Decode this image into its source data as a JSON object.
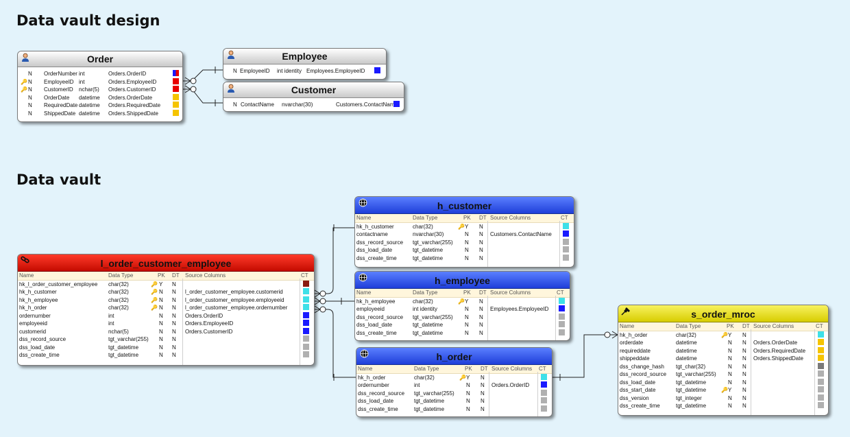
{
  "sections": {
    "design_title": "Data vault design",
    "vault_title": "Data vault"
  },
  "colors": {
    "background": "#e3f3fb",
    "hub_header": "#2a4fe8",
    "link_header": "#d81000",
    "satellite_header": "#e8e020",
    "ct_blue": "#1a1aff",
    "ct_red": "#e80000",
    "ct_yellow": "#f5c400",
    "ct_cyan": "#3ee0e8",
    "ct_grey": "#b0b0b0",
    "ct_darkred": "#8a1a10"
  },
  "order": {
    "title": "Order",
    "rows": [
      {
        "n": "N",
        "name": "OrderNumber",
        "type": "int",
        "src": "Orders.OrderID",
        "ct": "split",
        "key": false
      },
      {
        "n": "N",
        "name": "EmployeeID",
        "type": "int",
        "src": "Orders.EmployeeID",
        "ct": "#e80000",
        "key": true
      },
      {
        "n": "N",
        "name": "CustomerID",
        "type": "nchar(5)",
        "src": "Orders.CustomerID",
        "ct": "#e80000",
        "key": true
      },
      {
        "n": "N",
        "name": "OrderDate",
        "type": "datetime",
        "src": "Orders.OrderDate",
        "ct": "#f5c400",
        "key": false
      },
      {
        "n": "N",
        "name": "RequiredDate",
        "type": "datetime",
        "src": "Orders.RequiredDate",
        "ct": "#f5c400",
        "key": false
      },
      {
        "n": "N",
        "name": "ShippedDate",
        "type": "datetime",
        "src": "Orders.ShippedDate",
        "ct": "#f5c400",
        "key": false
      }
    ]
  },
  "employee": {
    "title": "Employee",
    "rows": [
      {
        "n": "N",
        "name": "EmployeeID",
        "type": "int identity",
        "src": "Employees.EmployeeID",
        "ct": "#1a1aff"
      }
    ]
  },
  "customer": {
    "title": "Customer",
    "rows": [
      {
        "n": "N",
        "name": "ContactName",
        "type": "nvarchar(30)",
        "src": "Customers.ContactName",
        "ct": "#1a1aff"
      }
    ]
  },
  "columns": {
    "name": "Name",
    "type": "Data Type",
    "pk": "PK",
    "dt": "DT",
    "src": "Source Columns",
    "ct": "CT"
  },
  "h_customer": {
    "title": "h_customer",
    "rows": [
      {
        "name": "hk_h_customer",
        "type": "char(32)",
        "pk": "Y",
        "dt": "N",
        "src": "",
        "ct": "#3ee0e8",
        "key": true
      },
      {
        "name": "contactname",
        "type": "nvarchar(30)",
        "pk": "N",
        "dt": "N",
        "src": "Customers.ContactName",
        "ct": "#1a1aff",
        "key": false
      },
      {
        "name": "dss_record_source",
        "type": "tgt_varchar(255)",
        "pk": "N",
        "dt": "N",
        "src": "",
        "ct": "#b0b0b0",
        "key": false
      },
      {
        "name": "dss_load_date",
        "type": "tgt_datetime",
        "pk": "N",
        "dt": "N",
        "src": "",
        "ct": "#b0b0b0",
        "key": false
      },
      {
        "name": "dss_create_time",
        "type": "tgt_datetime",
        "pk": "N",
        "dt": "N",
        "src": "",
        "ct": "#b0b0b0",
        "key": false
      }
    ]
  },
  "h_employee": {
    "title": "h_employee",
    "rows": [
      {
        "name": "hk_h_employee",
        "type": "char(32)",
        "pk": "Y",
        "dt": "N",
        "src": "",
        "ct": "#3ee0e8",
        "key": true
      },
      {
        "name": "employeeid",
        "type": "int identity",
        "pk": "N",
        "dt": "N",
        "src": "Employees.EmployeeID",
        "ct": "#1a1aff",
        "key": false
      },
      {
        "name": "dss_record_source",
        "type": "tgt_varchar(255)",
        "pk": "N",
        "dt": "N",
        "src": "",
        "ct": "#b0b0b0",
        "key": false
      },
      {
        "name": "dss_load_date",
        "type": "tgt_datetime",
        "pk": "N",
        "dt": "N",
        "src": "",
        "ct": "#b0b0b0",
        "key": false
      },
      {
        "name": "dss_create_time",
        "type": "tgt_datetime",
        "pk": "N",
        "dt": "N",
        "src": "",
        "ct": "#b0b0b0",
        "key": false
      }
    ]
  },
  "h_order": {
    "title": "h_order",
    "rows": [
      {
        "name": "hk_h_order",
        "type": "char(32)",
        "pk": "Y",
        "dt": "N",
        "src": "",
        "ct": "#3ee0e8",
        "key": true
      },
      {
        "name": "ordernumber",
        "type": "int",
        "pk": "N",
        "dt": "N",
        "src": "Orders.OrderID",
        "ct": "#1a1aff",
        "key": false
      },
      {
        "name": "dss_record_source",
        "type": "tgt_varchar(255)",
        "pk": "N",
        "dt": "N",
        "src": "",
        "ct": "#b0b0b0",
        "key": false
      },
      {
        "name": "dss_load_date",
        "type": "tgt_datetime",
        "pk": "N",
        "dt": "N",
        "src": "",
        "ct": "#b0b0b0",
        "key": false
      },
      {
        "name": "dss_create_time",
        "type": "tgt_datetime",
        "pk": "N",
        "dt": "N",
        "src": "",
        "ct": "#b0b0b0",
        "key": false
      }
    ]
  },
  "l_order_customer_employee": {
    "title": "l_order_customer_employee",
    "rows": [
      {
        "name": "hk_l_order_customer_employee",
        "type": "char(32)",
        "pk": "Y",
        "dt": "N",
        "src": "",
        "ct": "#8a1a10",
        "key": "gold"
      },
      {
        "name": "hk_h_customer",
        "type": "char(32)",
        "pk": "N",
        "dt": "N",
        "src": "l_order_customer_employee.customerid",
        "ct": "#3ee0e8",
        "key": "blue"
      },
      {
        "name": "hk_h_employee",
        "type": "char(32)",
        "pk": "N",
        "dt": "N",
        "src": "l_order_customer_employee.employeeid",
        "ct": "#3ee0e8",
        "key": "blue"
      },
      {
        "name": "hk_h_order",
        "type": "char(32)",
        "pk": "N",
        "dt": "N",
        "src": "l_order_customer_employee.ordernumber",
        "ct": "#3ee0e8",
        "key": "blue"
      },
      {
        "name": "ordernumber",
        "type": "int",
        "pk": "N",
        "dt": "N",
        "src": "Orders.OrderID",
        "ct": "#1a1aff",
        "key": ""
      },
      {
        "name": "employeeid",
        "type": "int",
        "pk": "N",
        "dt": "N",
        "src": "Orders.EmployeeID",
        "ct": "#1a1aff",
        "key": ""
      },
      {
        "name": "customerid",
        "type": "nchar(5)",
        "pk": "N",
        "dt": "N",
        "src": "Orders.CustomerID",
        "ct": "#1a1aff",
        "key": ""
      },
      {
        "name": "dss_record_source",
        "type": "tgt_varchar(255)",
        "pk": "N",
        "dt": "N",
        "src": "",
        "ct": "#b0b0b0",
        "key": ""
      },
      {
        "name": "dss_load_date",
        "type": "tgt_datetime",
        "pk": "N",
        "dt": "N",
        "src": "",
        "ct": "#b0b0b0",
        "key": ""
      },
      {
        "name": "dss_create_time",
        "type": "tgt_datetime",
        "pk": "N",
        "dt": "N",
        "src": "",
        "ct": "#b0b0b0",
        "key": ""
      }
    ]
  },
  "s_order_mroc": {
    "title": "s_order_mroc",
    "rows": [
      {
        "name": "hk_h_order",
        "type": "char(32)",
        "pk": "Y",
        "dt": "N",
        "src": "",
        "ct": "#3ee0e8",
        "key": true
      },
      {
        "name": "orderdate",
        "type": "datetime",
        "pk": "N",
        "dt": "N",
        "src": "Orders.OrderDate",
        "ct": "#f5c400",
        "key": false
      },
      {
        "name": "requireddate",
        "type": "datetime",
        "pk": "N",
        "dt": "N",
        "src": "Orders.RequiredDate",
        "ct": "#f5c400",
        "key": false
      },
      {
        "name": "shippeddate",
        "type": "datetime",
        "pk": "N",
        "dt": "N",
        "src": "Orders.ShippedDate",
        "ct": "#f5c400",
        "key": false
      },
      {
        "name": "dss_change_hash",
        "type": "tgt_char(32)",
        "pk": "N",
        "dt": "N",
        "src": "",
        "ct": "#7a7a7a",
        "key": false
      },
      {
        "name": "dss_record_source",
        "type": "tgt_varchar(255)",
        "pk": "N",
        "dt": "N",
        "src": "",
        "ct": "#b0b0b0",
        "key": false
      },
      {
        "name": "dss_load_date",
        "type": "tgt_datetime",
        "pk": "N",
        "dt": "N",
        "src": "",
        "ct": "#b0b0b0",
        "key": false
      },
      {
        "name": "dss_start_date",
        "type": "tgt_datetime",
        "pk": "Y",
        "dt": "N",
        "src": "",
        "ct": "#b0b0b0",
        "key": true
      },
      {
        "name": "dss_version",
        "type": "tgt_integer",
        "pk": "N",
        "dt": "N",
        "src": "",
        "ct": "#b0b0b0",
        "key": false
      },
      {
        "name": "dss_create_time",
        "type": "tgt_datetime",
        "pk": "N",
        "dt": "N",
        "src": "",
        "ct": "#b0b0b0",
        "key": false
      }
    ]
  }
}
